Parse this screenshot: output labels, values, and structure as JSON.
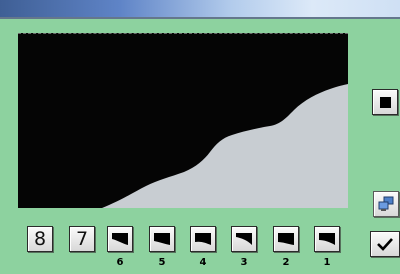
{
  "keys": {
    "digit_a": "8",
    "digit_b": "7"
  },
  "level_labels": [
    "6",
    "5",
    "4",
    "3",
    "2",
    "1"
  ],
  "icons": {
    "stop": "stop-icon",
    "profile": "profile-curve-icon",
    "settings": "computer-settings-icon",
    "confirm": "checkmark-icon"
  },
  "colors": {
    "panel": "#8dd29f",
    "display": "#050505",
    "profile_fill": "#c8cdd2"
  }
}
